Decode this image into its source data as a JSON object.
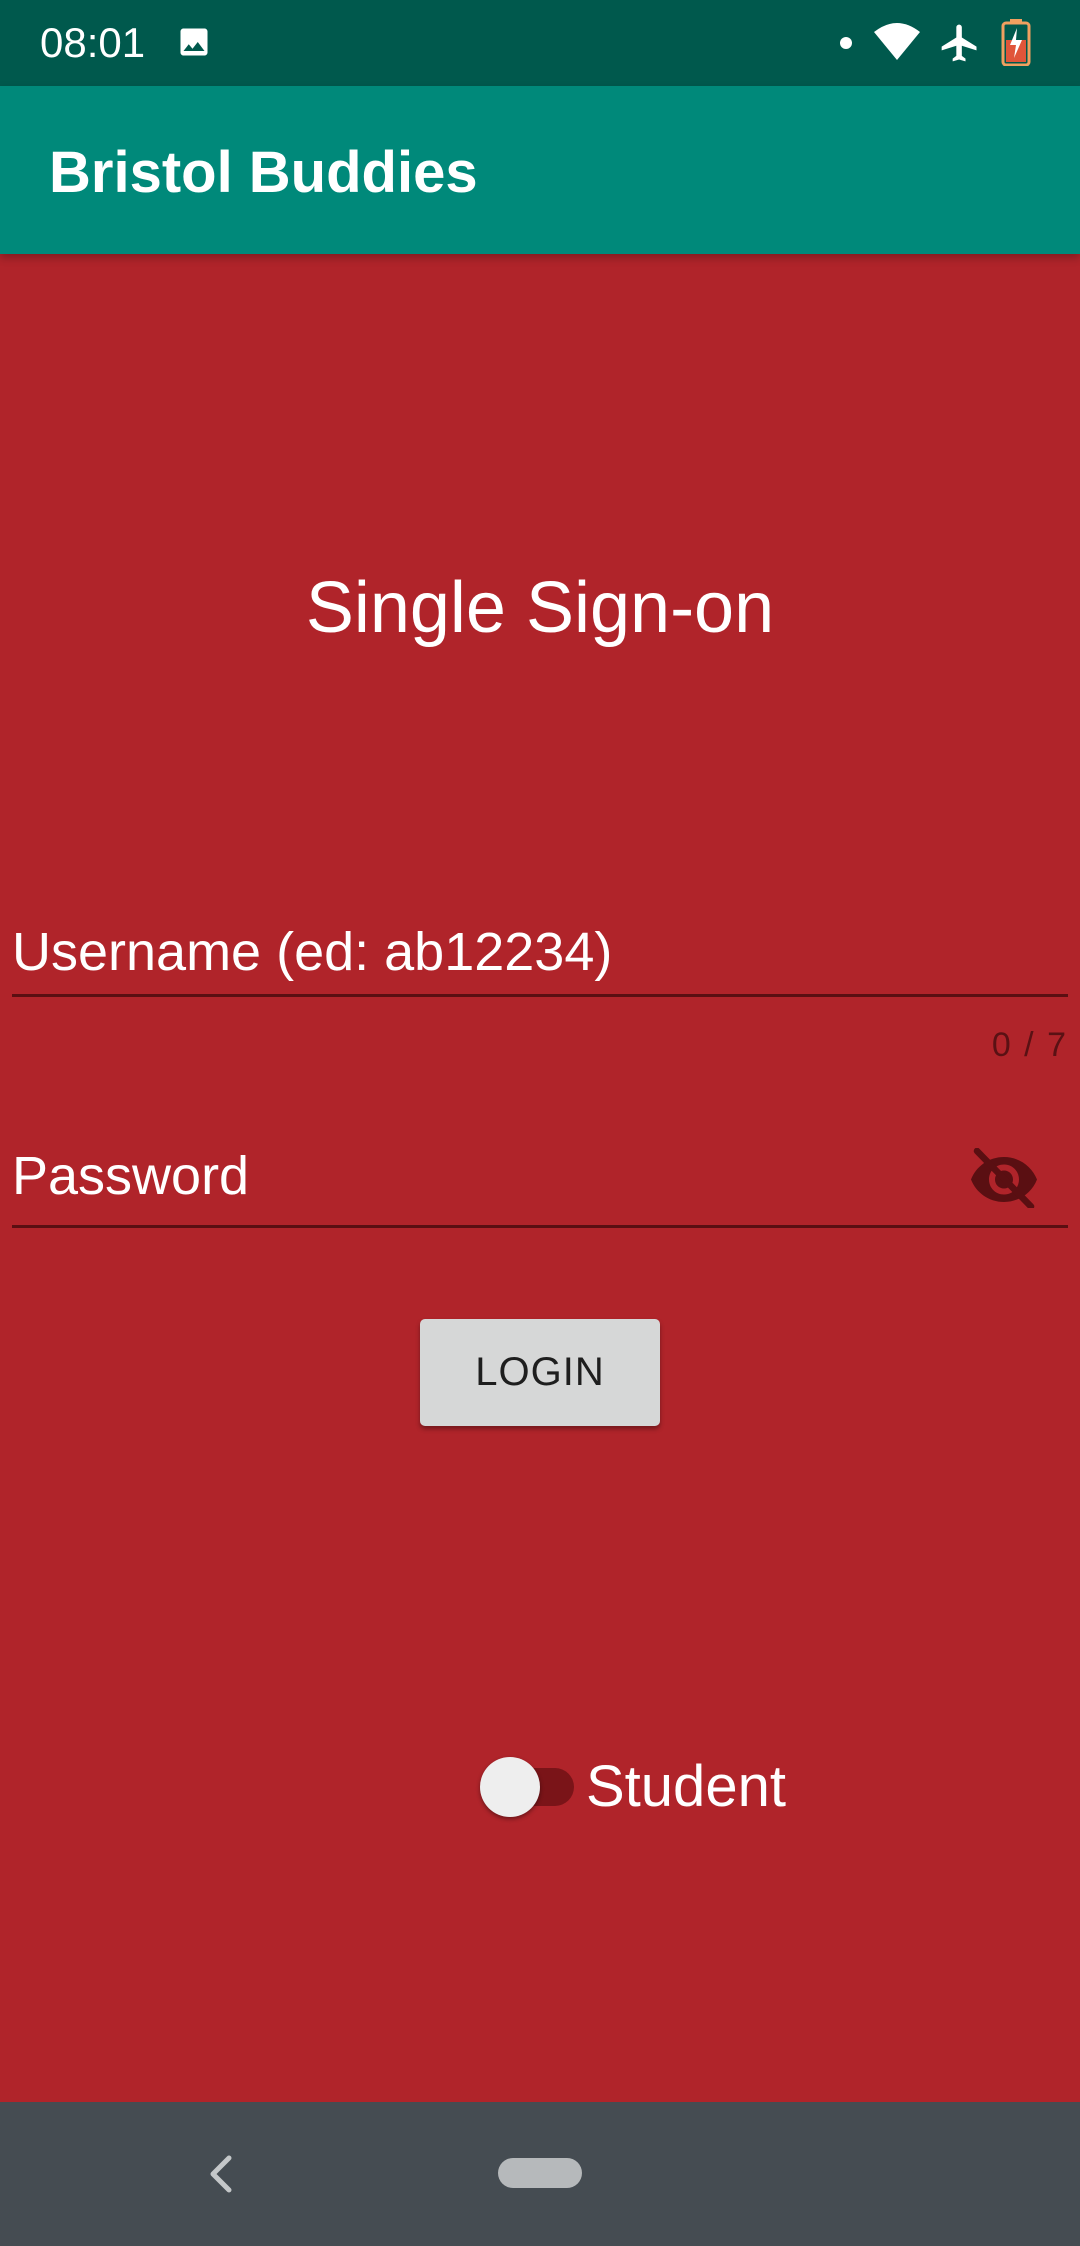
{
  "status_bar": {
    "time": "08:01",
    "icons": [
      "image-icon",
      "dot-icon",
      "wifi-icon",
      "airplane-icon",
      "battery-charging-icon"
    ]
  },
  "app_bar": {
    "title": "Bristol Buddies"
  },
  "login": {
    "heading": "Single Sign-on",
    "username_placeholder": "Username (ed: ab12234)",
    "username_counter": "0 / 7",
    "password_placeholder": "Password",
    "login_button": "LOGIN",
    "student_toggle_label": "Student",
    "student_toggle_on": false
  },
  "nav_bar": {
    "icons": [
      "back-icon",
      "home-pill-icon"
    ]
  },
  "colors": {
    "status_bar": "#00594d",
    "app_bar": "#00897a",
    "background": "#b0242a",
    "button": "#d6d7d7",
    "nav_bar": "#454c52"
  }
}
